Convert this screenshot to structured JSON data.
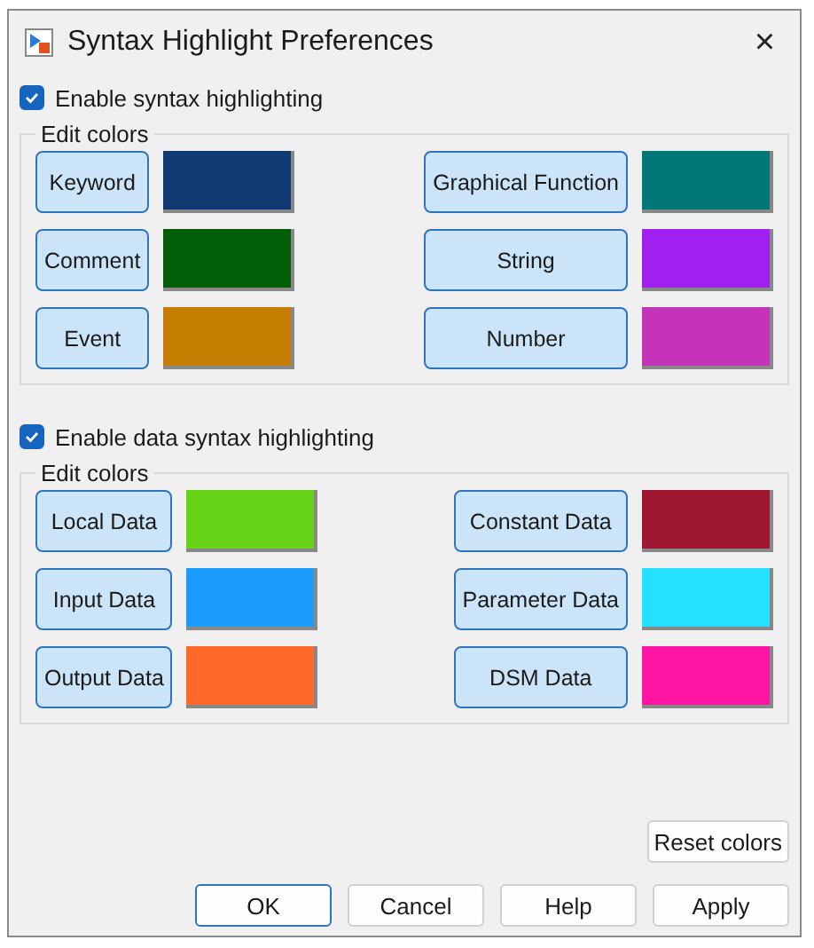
{
  "window": {
    "title": "Syntax Highlight Preferences",
    "close": "×"
  },
  "sections": [
    {
      "checkbox": {
        "label": "Enable syntax highlighting",
        "checked": true
      },
      "group_title": "Edit colors",
      "items": [
        {
          "label": "Keyword",
          "color": "#0f3a72"
        },
        {
          "label": "Graphical Function",
          "color": "#007878"
        },
        {
          "label": "Comment",
          "color": "#025e06"
        },
        {
          "label": "String",
          "color": "#a020f0"
        },
        {
          "label": "Event",
          "color": "#c47d00"
        },
        {
          "label": "Number",
          "color": "#c433b8"
        }
      ]
    },
    {
      "checkbox": {
        "label": "Enable data syntax highlighting",
        "checked": true
      },
      "group_title": "Edit colors",
      "items": [
        {
          "label": "Local Data",
          "color": "#66d316"
        },
        {
          "label": "Constant Data",
          "color": "#9e162f"
        },
        {
          "label": "Input Data",
          "color": "#1a9cff"
        },
        {
          "label": "Parameter Data",
          "color": "#23e1ff"
        },
        {
          "label": "Output Data",
          "color": "#ff6a2a"
        },
        {
          "label": "DSM Data",
          "color": "#ff14a4"
        }
      ]
    }
  ],
  "reset_button": "Reset colors",
  "buttons": [
    {
      "label": "OK",
      "default": true
    },
    {
      "label": "Cancel",
      "default": false
    },
    {
      "label": "Help",
      "default": false
    },
    {
      "label": "Apply",
      "default": false
    }
  ]
}
